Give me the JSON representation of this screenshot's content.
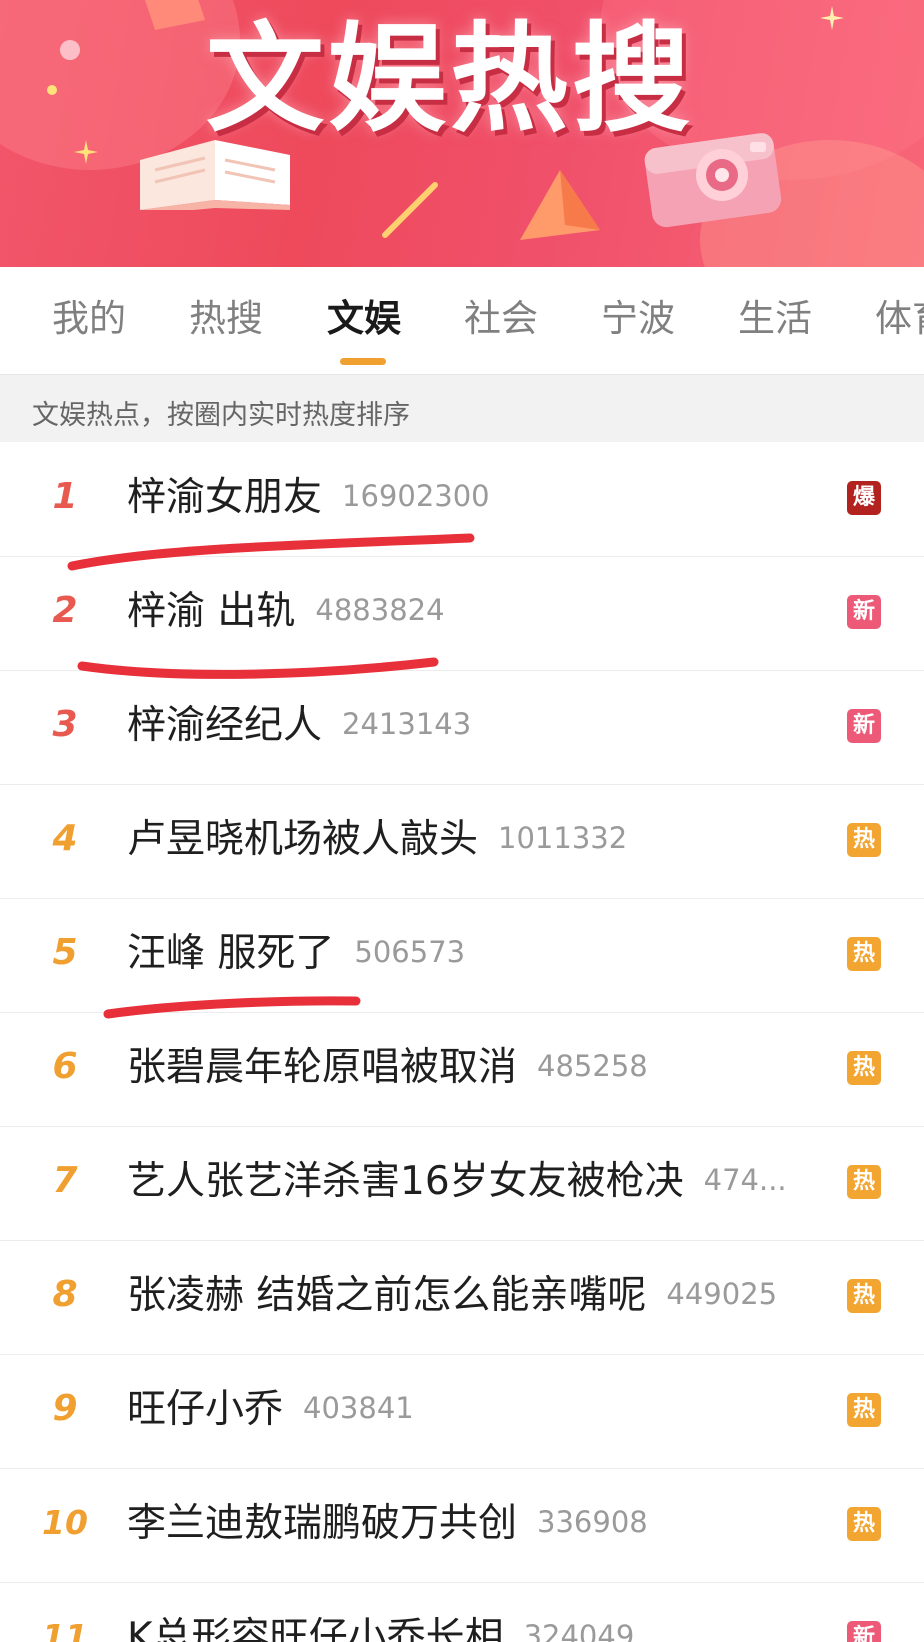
{
  "banner": {
    "title": "文娱热搜"
  },
  "tabs": [
    {
      "label": "我的"
    },
    {
      "label": "热搜"
    },
    {
      "label": "文娱"
    },
    {
      "label": "社会"
    },
    {
      "label": "宁波"
    },
    {
      "label": "生活"
    },
    {
      "label": "体育"
    }
  ],
  "active_tab": "文娱",
  "subtitle": "文娱热点，按圈内实时热度排序",
  "colors": {
    "rank_top": "#e85a4f",
    "rank_other": "#f0a030",
    "badge_bao": "#b2231f",
    "badge_xin": "#ec5a78",
    "badge_re": "#f2a531",
    "annotation": "#e8303a"
  },
  "items": [
    {
      "rank": "1",
      "title": "梓渝女朋友",
      "count": "16902300",
      "badge": "爆",
      "badge_type": "bao"
    },
    {
      "rank": "2",
      "title": "梓渝 出轨",
      "count": "4883824",
      "badge": "新",
      "badge_type": "xin"
    },
    {
      "rank": "3",
      "title": "梓渝经纪人",
      "count": "2413143",
      "badge": "新",
      "badge_type": "xin"
    },
    {
      "rank": "4",
      "title": "卢昱晓机场被人敲头",
      "count": "1011332",
      "badge": "热",
      "badge_type": "re"
    },
    {
      "rank": "5",
      "title": "汪峰 服死了",
      "count": "506573",
      "badge": "热",
      "badge_type": "re"
    },
    {
      "rank": "6",
      "title": "张碧晨年轮原唱被取消",
      "count": "485258",
      "badge": "热",
      "badge_type": "re"
    },
    {
      "rank": "7",
      "title": "艺人张艺洋杀害16岁女友被枪决",
      "count": "474...",
      "badge": "热",
      "badge_type": "re"
    },
    {
      "rank": "8",
      "title": "张凌赫 结婚之前怎么能亲嘴呢",
      "count": "449025",
      "badge": "热",
      "badge_type": "re"
    },
    {
      "rank": "9",
      "title": "旺仔小乔",
      "count": "403841",
      "badge": "热",
      "badge_type": "re"
    },
    {
      "rank": "10",
      "title": "李兰迪敖瑞鹏破万共创",
      "count": "336908",
      "badge": "热",
      "badge_type": "re"
    },
    {
      "rank": "11",
      "title": "K总形容旺仔小乔长相",
      "count": "324049",
      "badge": "新",
      "badge_type": "xin"
    }
  ]
}
